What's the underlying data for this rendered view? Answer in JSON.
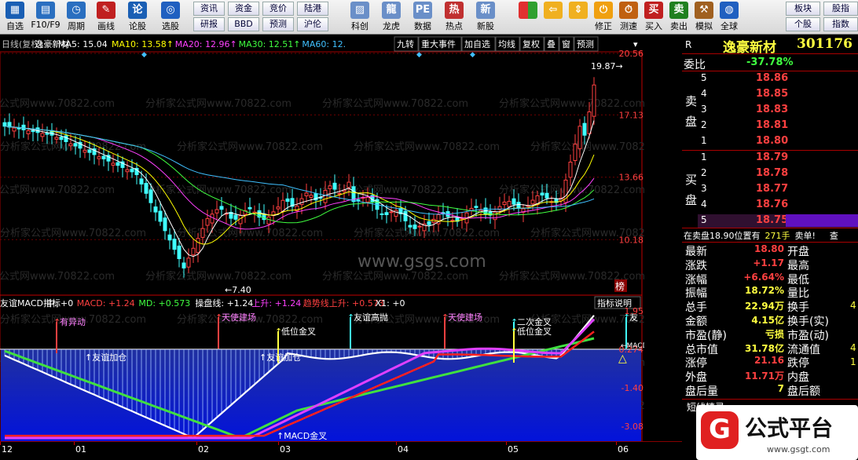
{
  "toolbar": [
    {
      "label": "自选",
      "icon": "grid",
      "color": "#1a5fb4"
    },
    {
      "label": "F10/F9",
      "icon": "doc",
      "color": "#2a6fc0"
    },
    {
      "label": "周期",
      "icon": "clock",
      "color": "#2a6fc0"
    },
    {
      "label": "画线",
      "icon": "pen",
      "color": "#c02020"
    },
    {
      "label": "论股",
      "icon": "bubble",
      "color": "#1a5fb4"
    },
    {
      "label": "选股",
      "icon": "target",
      "color": "#2060c0"
    }
  ],
  "small_buttons": [
    [
      "资讯",
      "研报"
    ],
    [
      "资金",
      "BBD"
    ],
    [
      "竞价",
      "预测"
    ],
    [
      "陆港",
      "沪伦"
    ]
  ],
  "toolbar2": [
    {
      "label": "科创",
      "icon": "chart"
    },
    {
      "label": "龙虎",
      "icon": "dragon"
    },
    {
      "label": "数据",
      "icon": "pe"
    },
    {
      "label": "热点",
      "icon": "hot"
    },
    {
      "label": "新股",
      "icon": "new"
    }
  ],
  "toolbar3": [
    {
      "label": "",
      "icon": "color-grid"
    },
    {
      "label": "",
      "icon": "arrow-left"
    },
    {
      "label": "",
      "icon": "arrow-up-down"
    },
    {
      "label": "修正",
      "icon": "power"
    },
    {
      "label": "测速",
      "icon": "stopwatch"
    },
    {
      "label": "买入",
      "icon": "buy"
    },
    {
      "label": "卖出",
      "icon": "sell"
    },
    {
      "label": "模拟",
      "icon": "hammer"
    },
    {
      "label": "全球",
      "icon": "globe"
    }
  ],
  "toolbar3_chars": {
    "buy": "买",
    "sell": "卖"
  },
  "right_buttons": [
    [
      "板块",
      "股指"
    ],
    [
      "个股",
      "指数"
    ]
  ],
  "chart_header": {
    "period": "日线(复权)",
    "name": "逸豪新材",
    "ma5": "MA5: 15.04",
    "ma10": "MA10: 13.58",
    "ma20": "MA20: 12.96",
    "ma30": "MA30: 12.51",
    "ma60": "MA60: 12.",
    "arrow": "↑"
  },
  "chart_tabs": [
    "九转",
    "重大事件",
    "加自选",
    "均线",
    "复权",
    "叠",
    "窗",
    "预测"
  ],
  "price_axis": [
    "20.56",
    "17.13",
    "13.66",
    "10.18"
  ],
  "high_label": "19.87",
  "low_label": "7.40",
  "bang_label": "榜",
  "watermark": "分析家公式网www.70822.com",
  "center_watermark": "www.gsgs.com",
  "indicator": {
    "title": "友谊MACD指标",
    "zhong": "中: +0",
    "macd": "MACD: +1.24",
    "md": "MD: +0.573",
    "caopan": "操盘线: +1.24",
    "up": "上升: +1.24",
    "trend": "趋势线上升: +0.573",
    "x1": "X1: +0",
    "button": "指标说明",
    "axis": [
      "1.95",
      "0.274",
      "-1.40",
      "-3.08"
    ]
  },
  "annotations": {
    "youyidong": "有异动",
    "dishengjin": "天使建场",
    "youyi_jiacang": "友谊加仓",
    "diwei": "低位金叉",
    "gaopao": "友谊高抛",
    "erci": "二次金叉",
    "macd_jin": "MACD金叉",
    "macd_label": "MACD",
    "you": "友"
  },
  "date_labels": [
    "12",
    "01",
    "02",
    "03",
    "04",
    "05",
    "06"
  ],
  "quote": {
    "title": "逸豪新材",
    "code": "301176",
    "weibi_label": "委比",
    "weibi": "-37.78%",
    "sell_label": "卖盘",
    "buy_label": "买盘",
    "sell": [
      {
        "n": "5",
        "p": "18.86"
      },
      {
        "n": "4",
        "p": "18.85"
      },
      {
        "n": "3",
        "p": "18.83"
      },
      {
        "n": "2",
        "p": "18.81"
      },
      {
        "n": "1",
        "p": "18.80"
      }
    ],
    "buy": [
      {
        "n": "1",
        "p": "18.79"
      },
      {
        "n": "2",
        "p": "18.78"
      },
      {
        "n": "3",
        "p": "18.77"
      },
      {
        "n": "4",
        "p": "18.76"
      },
      {
        "n": "5",
        "p": "18.75"
      }
    ],
    "notice": "在卖盘18.90位置有",
    "notice_vol": "271手",
    "notice_tail": "卖单!",
    "notice_more": "查",
    "rows": [
      {
        "l": "最新",
        "v": "18.80",
        "r": "开盘",
        "vc": "#ff4040"
      },
      {
        "l": "涨跌",
        "v": "+1.17",
        "r": "最高",
        "vc": "#ff4040"
      },
      {
        "l": "涨幅",
        "v": "+6.64%",
        "r": "最低",
        "vc": "#ff4040"
      },
      {
        "l": "振幅",
        "v": "18.72%",
        "r": "量比",
        "vc": "#ffff40"
      },
      {
        "l": "总手",
        "v": "22.94万",
        "r": "换手",
        "vc": "#ffff40"
      },
      {
        "l": "金额",
        "v": "4.15亿",
        "r": "换手(实)",
        "vc": "#ffff40"
      },
      {
        "l": "市盈(静)",
        "v": "亏损",
        "r": "市盈(动)",
        "vc": "#ffff40"
      },
      {
        "l": "总市值",
        "v": "31.78亿",
        "r": "流通值",
        "vc": "#ffff40"
      },
      {
        "l": "涨停",
        "v": "21.16",
        "r": "跌停",
        "vc": "#ff4040"
      },
      {
        "l": "外盘",
        "v": "11.71万",
        "r": "内盘",
        "vc": "#ff4040"
      },
      {
        "l": "盘后量",
        "v": "7",
        "r": "盘后额",
        "vc": "#ffff40"
      }
    ],
    "right_digits": [
      "4",
      "4",
      "1"
    ],
    "r_label": "R",
    "shortline": "短线精灵"
  },
  "logo": {
    "text": "公式平台",
    "url": "www.gsgt.com"
  },
  "colors": {
    "ma5": "#ffffff",
    "ma10": "#ffff00",
    "ma20": "#ff40ff",
    "ma30": "#40ff40",
    "ma60": "#40c0ff",
    "up": "#ff4040",
    "down": "#40ffff"
  }
}
